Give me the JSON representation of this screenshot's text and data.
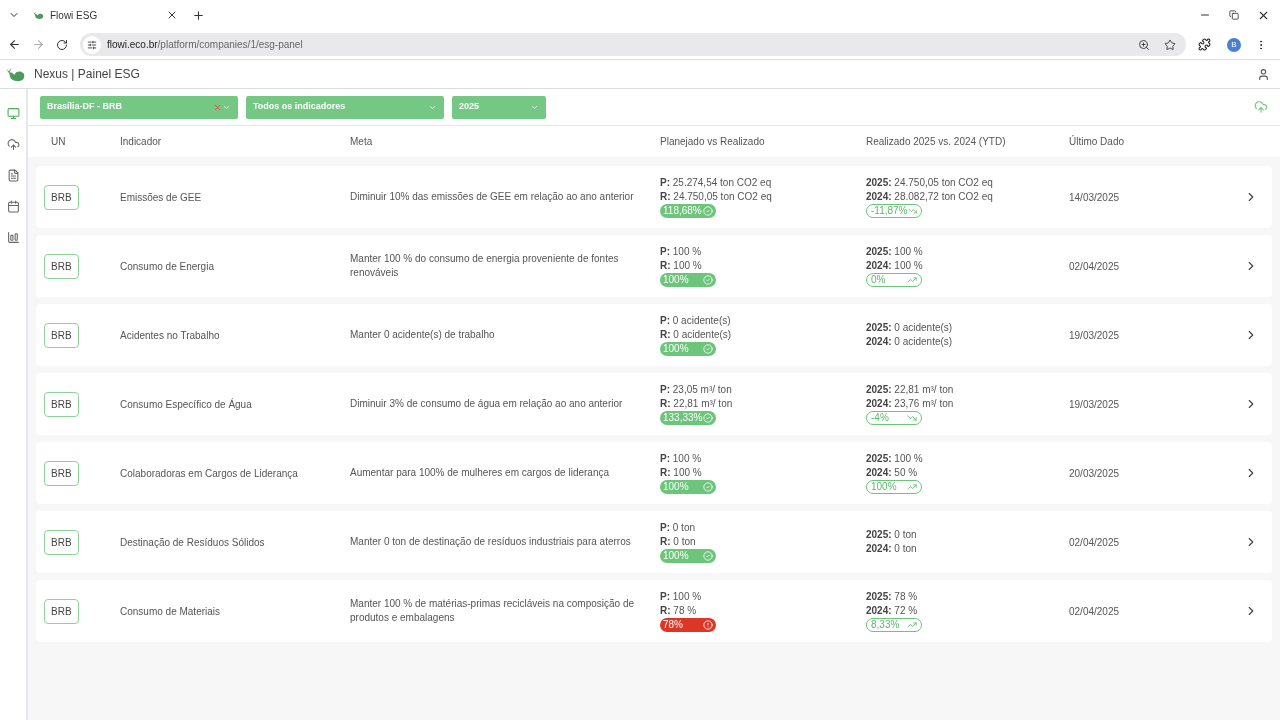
{
  "browser": {
    "tab_title": "Flowi ESG",
    "url_domain": "flowi.eco.br",
    "url_path": "/platform/companies/1/esg-panel",
    "profile_initial": "B"
  },
  "app": {
    "title": "Nexus | Painel ESG"
  },
  "sidebar": {
    "items": [
      {
        "kind": "monitor",
        "selected": true
      },
      {
        "kind": "cloud",
        "selected": false
      },
      {
        "kind": "document",
        "selected": false
      },
      {
        "kind": "calendar",
        "selected": false
      },
      {
        "kind": "chart",
        "selected": false
      }
    ]
  },
  "filters": [
    {
      "value": "Brasília-DF - BRB",
      "clearable": true
    },
    {
      "value": "Todos os indicadores",
      "clearable": false
    },
    {
      "value": "2025",
      "clearable": false
    }
  ],
  "table": {
    "columns": [
      "UN",
      "Indicador",
      "Meta",
      "Planejado vs Realizado",
      "Realizado 2025 vs. 2024 (YTD)",
      "Último Dado"
    ],
    "rows": [
      {
        "un": "BRB",
        "indicator": "Emissões de GEE",
        "goal": "Diminuir 10% das emissões de GEE em relação ao ano anterior",
        "planned": {
          "label": "P:",
          "value": "25.274,54 ton CO2 eq"
        },
        "realized": {
          "label": "R:",
          "value": "24.750,05 ton CO2 eq"
        },
        "status": {
          "text": "118,68%",
          "kind": "ok"
        },
        "current": {
          "label": "2025:",
          "value": "24.750,05 ton CO2 eq"
        },
        "previous": {
          "label": "2024:",
          "value": "28.082,72 ton CO2 eq"
        },
        "trend": {
          "text": "-11,87%",
          "kind": "down"
        },
        "last_date": "14/03/2025"
      },
      {
        "un": "BRB",
        "indicator": "Consumo de Energia",
        "goal": "Manter 100 % do consumo de energia proveniente de fontes renováveis",
        "planned": {
          "label": "P:",
          "value": "100 %"
        },
        "realized": {
          "label": "R:",
          "value": "100 %"
        },
        "status": {
          "text": "100%",
          "kind": "ok"
        },
        "current": {
          "label": "2025:",
          "value": "100 %"
        },
        "previous": {
          "label": "2024:",
          "value": "100 %"
        },
        "trend": {
          "text": "0%",
          "kind": "up"
        },
        "last_date": "02/04/2025"
      },
      {
        "un": "BRB",
        "indicator": "Acidentes no Trabalho",
        "goal": "Manter 0 acidente(s) de trabalho",
        "planned": {
          "label": "P:",
          "value": "0 acidente(s)"
        },
        "realized": {
          "label": "R:",
          "value": "0 acidente(s)"
        },
        "status": {
          "text": "100%",
          "kind": "ok"
        },
        "current": {
          "label": "2025:",
          "value": "0 acidente(s)"
        },
        "previous": {
          "label": "2024:",
          "value": "0 acidente(s)"
        },
        "last_date": "19/03/2025"
      },
      {
        "un": "BRB",
        "indicator": "Consumo Específico de Água",
        "goal": "Diminuir 3% de consumo de água em relação ao ano anterior",
        "planned": {
          "label": "P:",
          "value": "23,05 m³/ ton"
        },
        "realized": {
          "label": "R:",
          "value": "22,81 m³/ ton"
        },
        "status": {
          "text": "133,33%",
          "kind": "ok"
        },
        "current": {
          "label": "2025:",
          "value": "22,81 m³/ ton"
        },
        "previous": {
          "label": "2024:",
          "value": "23,76 m³/ ton"
        },
        "trend": {
          "text": "-4%",
          "kind": "down"
        },
        "last_date": "19/03/2025"
      },
      {
        "un": "BRB",
        "indicator": "Colaboradoras em Cargos de Liderança",
        "goal": "Aumentar para 100% de mulheres em cargos de liderança",
        "planned": {
          "label": "P:",
          "value": "100 %"
        },
        "realized": {
          "label": "R:",
          "value": "100 %"
        },
        "status": {
          "text": "100%",
          "kind": "ok"
        },
        "current": {
          "label": "2025:",
          "value": "100 %"
        },
        "previous": {
          "label": "2024:",
          "value": "50 %"
        },
        "trend": {
          "text": "100%",
          "kind": "up"
        },
        "last_date": "20/03/2025"
      },
      {
        "un": "BRB",
        "indicator": "Destinação de Resíduos Sólidos",
        "goal": "Manter 0 ton de destinação de resíduos industriais para aterros",
        "planned": {
          "label": "P:",
          "value": "0 ton"
        },
        "realized": {
          "label": "R:",
          "value": "0 ton"
        },
        "status": {
          "text": "100%",
          "kind": "ok"
        },
        "current": {
          "label": "2025:",
          "value": "0 ton"
        },
        "previous": {
          "label": "2024:",
          "value": "0 ton"
        },
        "last_date": "02/04/2025"
      },
      {
        "un": "BRB",
        "indicator": "Consumo de Materiais",
        "goal": "Manter 100 % de matérias-primas recicláveis na composição de produtos e embalagens",
        "planned": {
          "label": "P:",
          "value": "100 %"
        },
        "realized": {
          "label": "R:",
          "value": "78 %"
        },
        "status": {
          "text": "78%",
          "kind": "alert"
        },
        "current": {
          "label": "2025:",
          "value": "78 %"
        },
        "previous": {
          "label": "2024:",
          "value": "72 %"
        },
        "trend": {
          "text": "8,33%",
          "kind": "up"
        },
        "last_date": "02/04/2025"
      }
    ]
  }
}
